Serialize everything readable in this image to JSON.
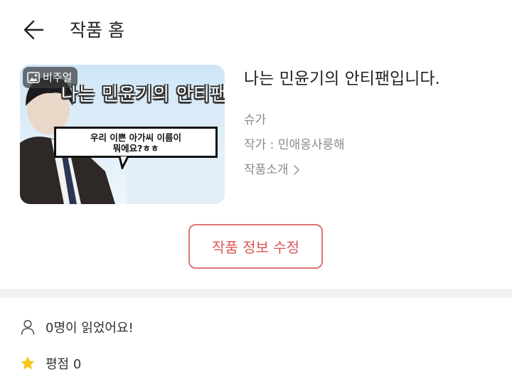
{
  "header": {
    "title": "작품 홈",
    "back_icon": "arrow-left-icon"
  },
  "work": {
    "title": "나는 민윤기의 안티팬입니다.",
    "genre": "슈가",
    "author_label": "작가 : 민애옹사룽해",
    "intro_label": "작품소개",
    "cover": {
      "badge": "비주얼",
      "badge_icon": "image-icon",
      "headline": "나는 민윤기의 안티팬입니다",
      "bubble_line1": "우리 이쁜 아가씨 이름이",
      "bubble_line2": "뭐에요?ㅎㅎ"
    }
  },
  "actions": {
    "edit_label": "작품 정보 수정"
  },
  "stats": {
    "readers_label": "0명이 읽었어요!",
    "readers_icon": "person-icon",
    "rating_label": "평점 0",
    "rating_icon": "star-icon"
  },
  "colors": {
    "accent": "#dc5656",
    "accent_border": "#e07474",
    "star": "#f5c518",
    "muted_text": "#8a8a8a",
    "divider": "#f1f2f4"
  }
}
